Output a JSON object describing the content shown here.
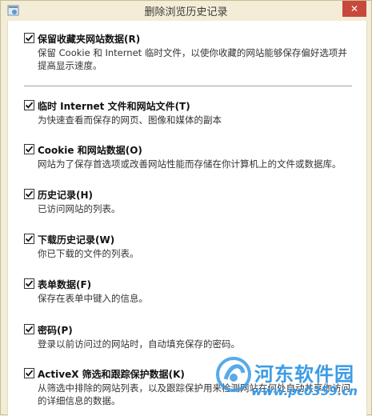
{
  "window": {
    "title": "删除浏览历史记录",
    "close_label": "✕"
  },
  "options": [
    {
      "label": "保留收藏夹网站数据(R)",
      "checked": true,
      "description": "保留 Cookie 和 Internet 临时文件，以使你收藏的网站能够保存偏好选项并提高显示速度。"
    },
    {
      "label": "临时 Internet 文件和网站文件(T)",
      "checked": true,
      "description": "为快速查看而保存的网页、图像和媒体的副本"
    },
    {
      "label": "Cookie 和网站数据(O)",
      "checked": true,
      "description": "网站为了保存首选项或改善网站性能而存储在你计算机上的文件或数据库。"
    },
    {
      "label": "历史记录(H)",
      "checked": true,
      "description": "已访问网站的列表。"
    },
    {
      "label": "下载历史记录(W)",
      "checked": true,
      "description": "你已下载的文件的列表。"
    },
    {
      "label": "表单数据(F)",
      "checked": true,
      "description": "保存在表单中键入的信息。"
    },
    {
      "label": "密码(P)",
      "checked": true,
      "description": "登录以前访问过的网站时，自动填充保存的密码。"
    },
    {
      "label": "ActiveX 筛选和跟踪保护数据(K)",
      "checked": true,
      "description": "从筛选中排除的网站列表，以及跟踪保护用来检测网站在何处自动共享你访问的详细信息的数据。"
    }
  ],
  "watermark": {
    "name": "河东软件园",
    "url": "www.pc0359.cn"
  }
}
